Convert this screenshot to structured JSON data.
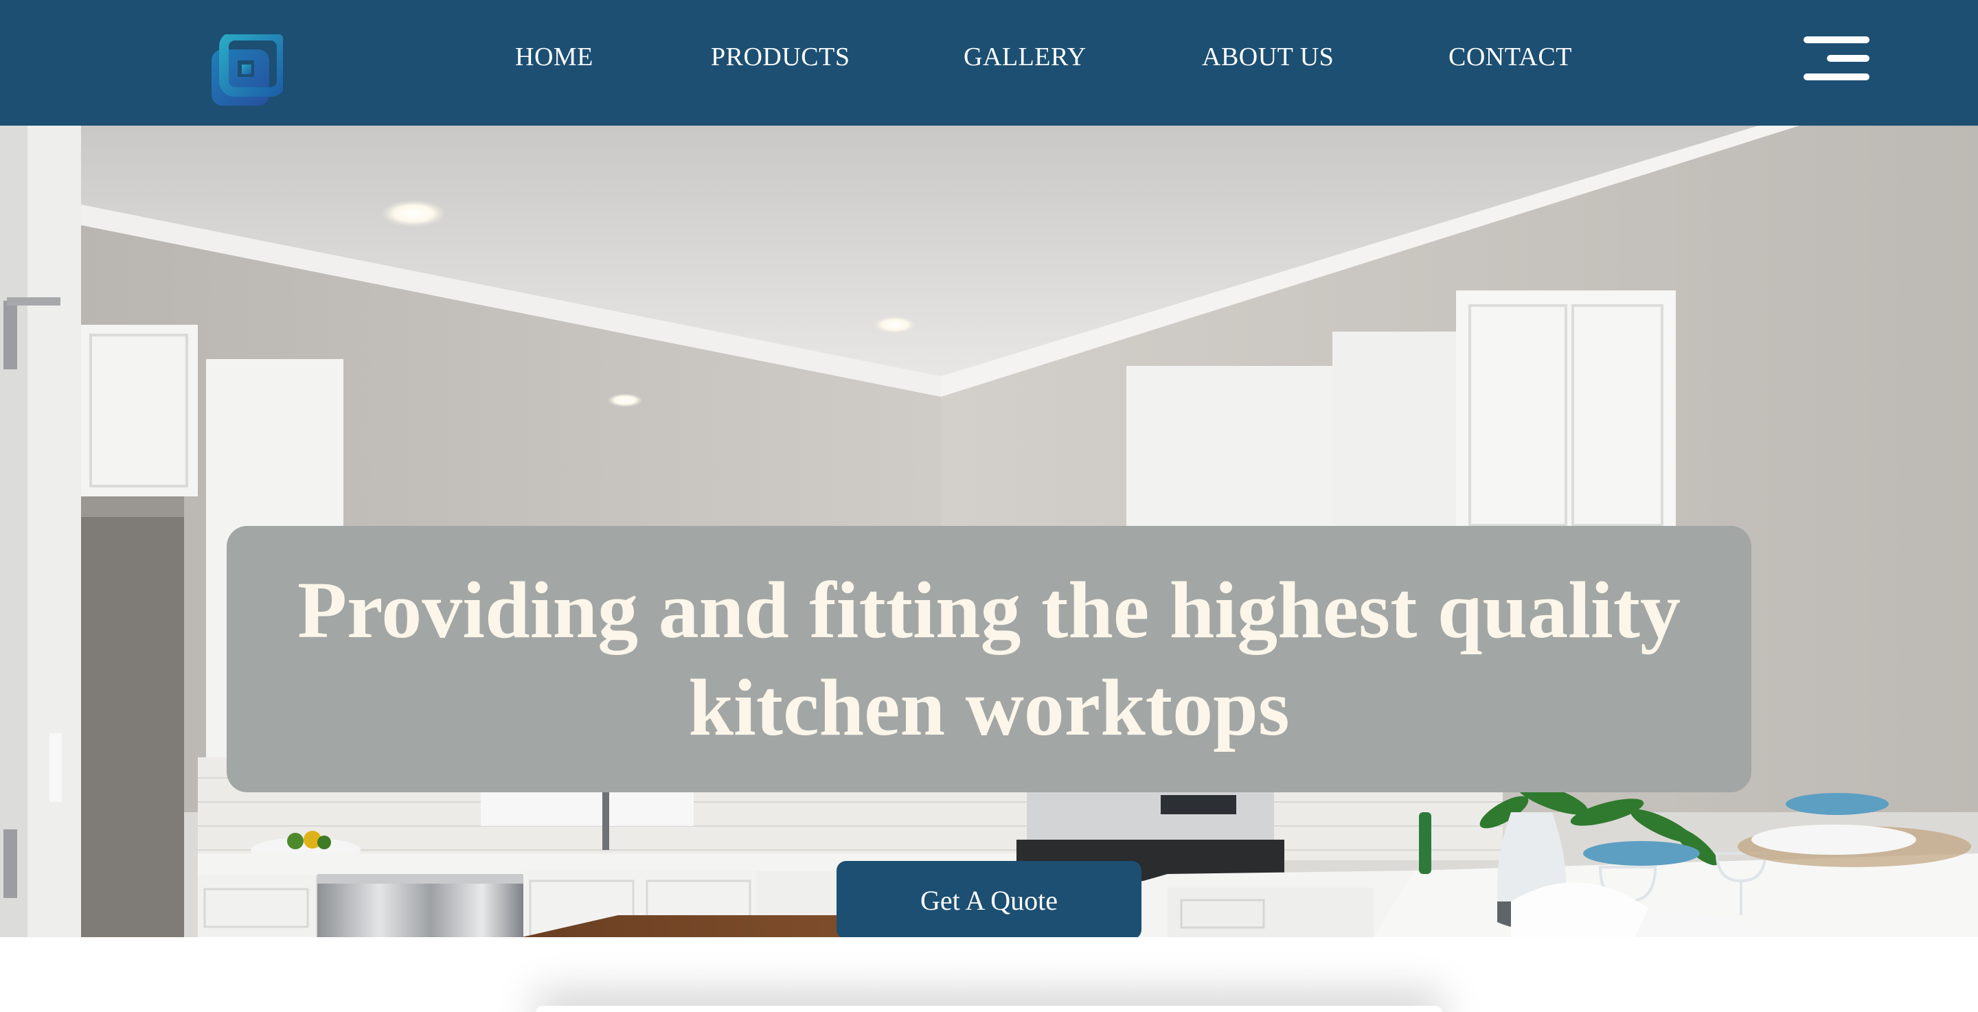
{
  "nav": {
    "logo_icon": "cube-logo-icon",
    "links": [
      "HOME",
      "PRODUCTS",
      "GALLERY",
      "ABOUT US",
      "CONTACT"
    ],
    "menu_icon": "hamburger-menu-icon",
    "background_color": "#1c4f72"
  },
  "hero": {
    "image": "kitchen-interior",
    "headline": "Providing and fitting the highest quality kitchen worktops",
    "cta_label": "Get A Quote",
    "headline_box_color": "#a2a6a5",
    "headline_text_color": "#fbf6e9",
    "cta_color": "#1c4f72"
  }
}
